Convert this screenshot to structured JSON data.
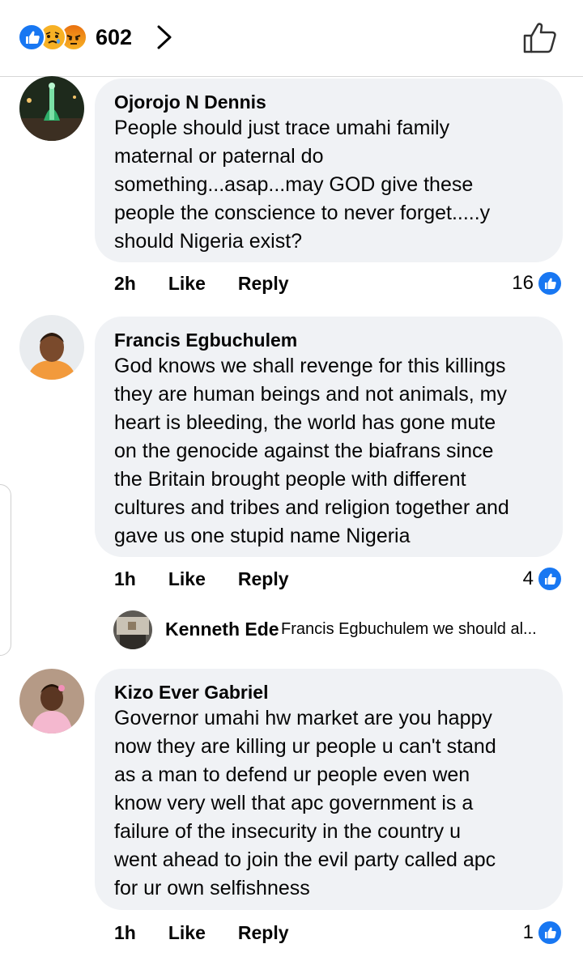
{
  "header": {
    "reaction_count": "602",
    "reactions": [
      "like-icon",
      "sad-icon",
      "angry-icon"
    ]
  },
  "comments": [
    {
      "author": "Ojorojo N Dennis",
      "lines": [
        "People should just trace umahi family",
        "maternal or paternal do",
        "something...asap...may GOD give these",
        "people the conscience to never forget.....y",
        "should Nigeria exist?"
      ],
      "time": "2h",
      "like_label": "Like",
      "reply_label": "Reply",
      "likes": "16"
    },
    {
      "author": "Francis Egbuchulem",
      "lines": [
        "God knows we shall revenge for this killings",
        "they are human beings and not animals, my",
        "heart is bleeding, the world has gone mute",
        "on the genocide against the biafrans since",
        "the Britain brought people with different",
        "cultures and tribes and religion together and",
        "gave us one stupid name Nigeria"
      ],
      "time": "1h",
      "like_label": "Like",
      "reply_label": "Reply",
      "likes": "4",
      "reply_preview": {
        "author": "Kenneth Ede",
        "text": "Francis Egbuchulem we should al..."
      }
    },
    {
      "author": "Kizo Ever Gabriel",
      "lines": [
        "Governor umahi hw market are you happy",
        "now they are killing ur people u can't stand",
        "as a man to defend ur people even wen",
        "know very well that apc government is a",
        "failure of the insecurity in the country u",
        "went ahead to join the evil party called apc",
        "for ur own selfishness"
      ],
      "time": "1h",
      "like_label": "Like",
      "reply_label": "Reply",
      "likes": "1"
    }
  ],
  "colors": {
    "like_blue": "#1877f2",
    "bubble_bg": "#f0f2f5"
  }
}
